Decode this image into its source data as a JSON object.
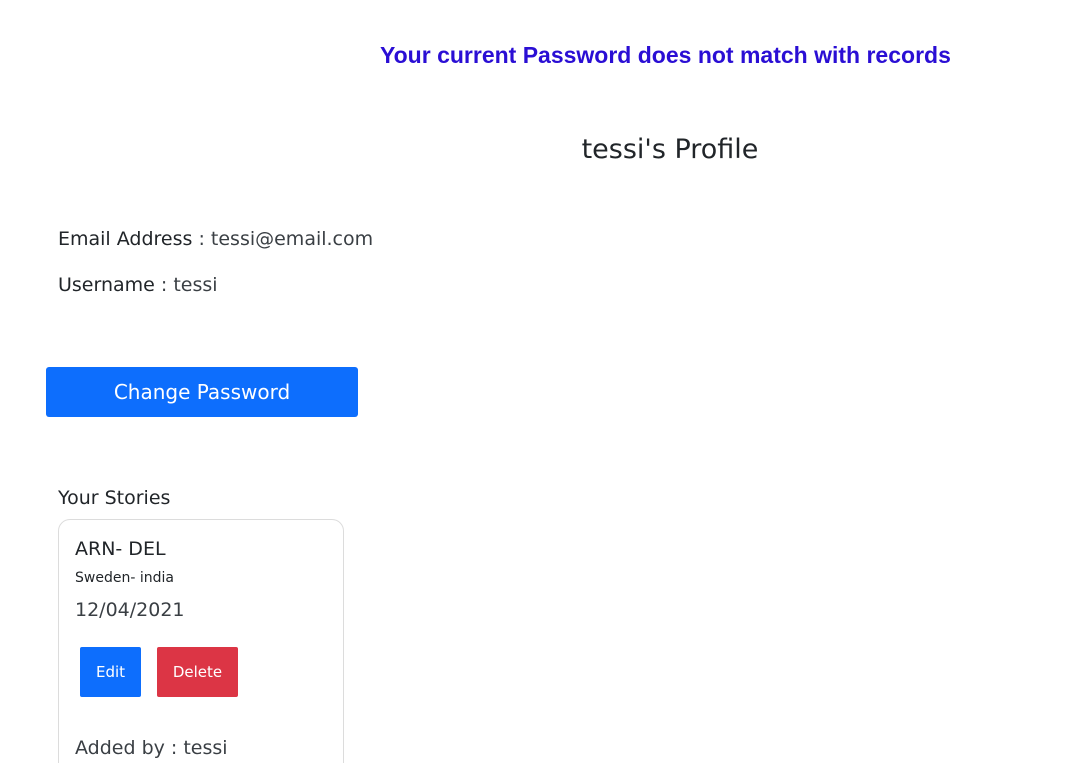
{
  "alert": {
    "message": "Your current Password does not match with records"
  },
  "profile": {
    "title": "tessi's Profile",
    "email_label": "Email Address",
    "email_value": " : tessi@email.com",
    "username_label": "Username",
    "username_value": " : tessi",
    "change_password_label": "Change Password"
  },
  "stories": {
    "heading": "Your Stories",
    "items": [
      {
        "title": "ARN- DEL",
        "subtitle": "Sweden- india",
        "date": "12/04/2021",
        "edit_label": "Edit",
        "delete_label": "Delete",
        "added_by": "Added by : tessi"
      }
    ]
  },
  "colors": {
    "alert_text": "#2a0ed4",
    "primary": "#0d6efd",
    "danger": "#dc3545"
  }
}
